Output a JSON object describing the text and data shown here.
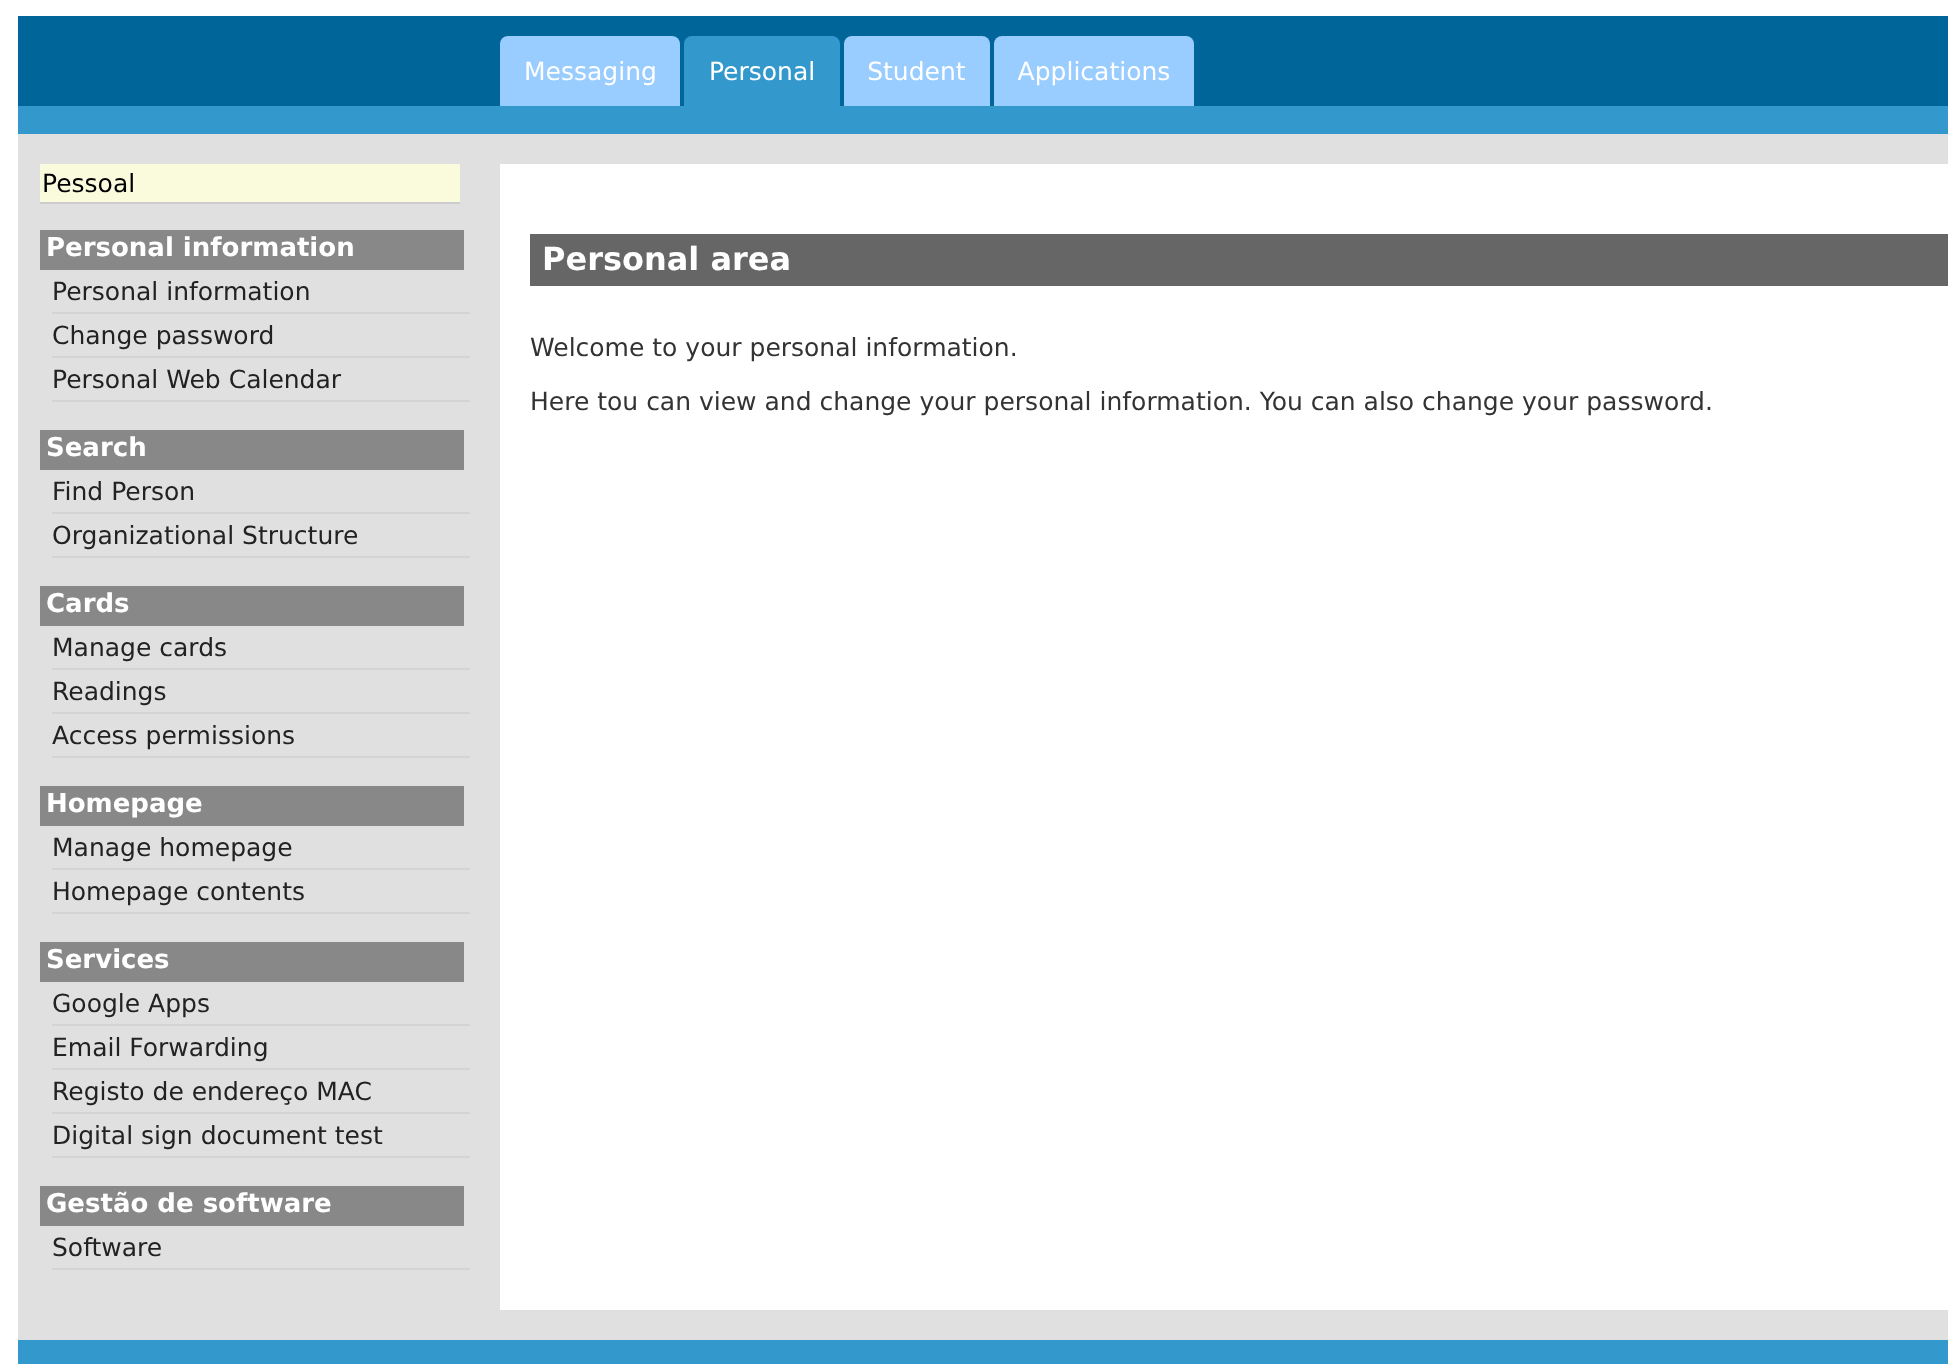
{
  "tabs": [
    {
      "label": "Messaging",
      "selected": false
    },
    {
      "label": "Personal",
      "selected": true
    },
    {
      "label": "Student",
      "selected": false
    },
    {
      "label": "Applications",
      "selected": false
    }
  ],
  "sidebar": {
    "title": "Pessoal",
    "sections": [
      {
        "heading": "Personal information",
        "items": [
          "Personal information",
          "Change password",
          "Personal Web Calendar"
        ]
      },
      {
        "heading": "Search",
        "items": [
          "Find Person",
          "Organizational Structure"
        ]
      },
      {
        "heading": "Cards",
        "items": [
          "Manage cards",
          "Readings",
          "Access permissions"
        ]
      },
      {
        "heading": "Homepage",
        "items": [
          "Manage homepage",
          "Homepage contents"
        ]
      },
      {
        "heading": "Services",
        "items": [
          "Google Apps",
          "Email Forwarding",
          "Registo de endereço MAC",
          "Digital sign document test"
        ]
      },
      {
        "heading": "Gestão de software",
        "items": [
          "Software"
        ]
      }
    ]
  },
  "content": {
    "title": "Personal area",
    "paragraphs": [
      "Welcome to your personal information.",
      "Here tou can view and change your personal information. You can also change your password."
    ]
  }
}
